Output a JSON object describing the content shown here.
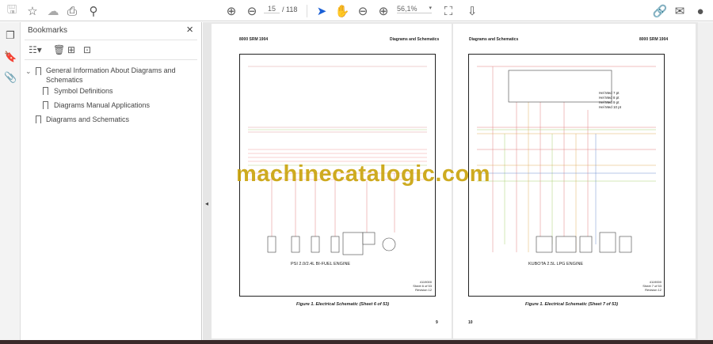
{
  "toolbar": {
    "current_page": "15",
    "total_pages": "/ 118",
    "zoom": "56,1%"
  },
  "bookmarks": {
    "title": "Bookmarks",
    "items": [
      {
        "label": "General Information About Diagrams and",
        "label2": "Schematics"
      },
      {
        "label": "Symbol Definitions"
      },
      {
        "label": "Diagrams Manual Applications"
      },
      {
        "label": "Diagrams and Schematics"
      }
    ]
  },
  "pages": [
    {
      "header_left": "8000 SRM 1904",
      "header_right": "Diagrams and Schematics",
      "engine": "PSI 2.0/2.4L BI-FUEL ENGINE",
      "ref": "4119000",
      "sheet": "Sheet 6 of 53",
      "revision": "Revision 12",
      "caption": "Figure 1. Electrical Schematic (Sheet 6 of 53)",
      "page_number": "9"
    },
    {
      "header_left": "Diagrams and Schematics",
      "header_right": "8000 SRM 1904",
      "engine": "KUBOTA 2.5L LPG ENGINE",
      "ref": "4119000",
      "sheet": "Sheet 7 of 53",
      "revision": "Revision 12",
      "caption": "Figure 1. Electrical Schematic (Sheet 7 of 53)",
      "page_number": "10",
      "notes": [
        "Hel Med 7 pt",
        "Hel Med 8 pt",
        "Hel Med 9 pt",
        "Hel Med 10 pt"
      ]
    }
  ],
  "watermark": "machinecatalogic.com"
}
